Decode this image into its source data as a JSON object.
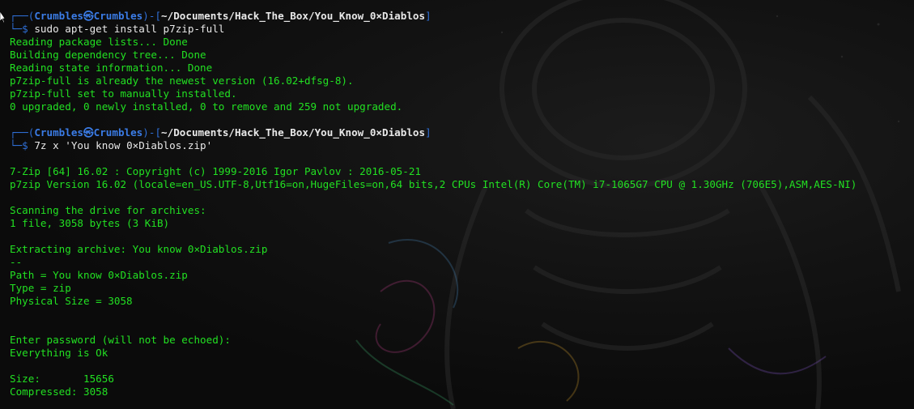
{
  "prompt_1": {
    "frame_left": "┌──(",
    "user": "Crumbles",
    "at_symbol": "㉿",
    "host": "Crumbles",
    "frame_mid": ")-[",
    "path": "~/Documents/Hack_The_Box/You_Know_0×Diablos",
    "frame_right": "]",
    "frame_bottom": "└─$",
    "command": " sudo apt-get install p7zip-full"
  },
  "output_1": [
    "Reading package lists... Done",
    "Building dependency tree... Done",
    "Reading state information... Done",
    "p7zip-full is already the newest version (16.02+dfsg-8).",
    "p7zip-full set to manually installed.",
    "0 upgraded, 0 newly installed, 0 to remove and 259 not upgraded."
  ],
  "prompt_2": {
    "frame_left": "┌──(",
    "user": "Crumbles",
    "at_symbol": "㉿",
    "host": "Crumbles",
    "frame_mid": ")-[",
    "path": "~/Documents/Hack_The_Box/You_Know_0×Diablos",
    "frame_right": "]",
    "frame_bottom": "└─$",
    "command": " 7z x 'You know 0×Diablos.zip'"
  },
  "output_2": {
    "copyright": "7-Zip [64] 16.02 : Copyright (c) 1999-2016 Igor Pavlov : 2016-05-21",
    "version": "p7zip Version 16.02 (locale=en_US.UTF-8,Utf16=on,HugeFiles=on,64 bits,2 CPUs Intel(R) Core(TM) i7-1065G7 CPU @ 1.30GHz (706E5),ASM,AES-NI)",
    "scanning": "Scanning the drive for archives:",
    "files": "1 file, 3058 bytes (3 KiB)",
    "extracting": "Extracting archive: You know 0×Diablos.zip",
    "separator": "--",
    "path_line": "Path = You know 0×Diablos.zip",
    "type_line": "Type = zip",
    "physical_size": "Physical Size = 3058",
    "password_prompt": "Enter password (will not be echoed):",
    "ok": "Everything is Ok",
    "size_line": "Size:       15656",
    "compressed_line": "Compressed: 3058"
  },
  "colors": {
    "output_green": "#22e022",
    "frame_blue": "#2f6fd6",
    "user_blue": "#3b7ce6",
    "path_white": "#e8e8e8",
    "background": "#0b0b0b"
  },
  "icons": {
    "pointer": "mouse-pointer-icon"
  }
}
